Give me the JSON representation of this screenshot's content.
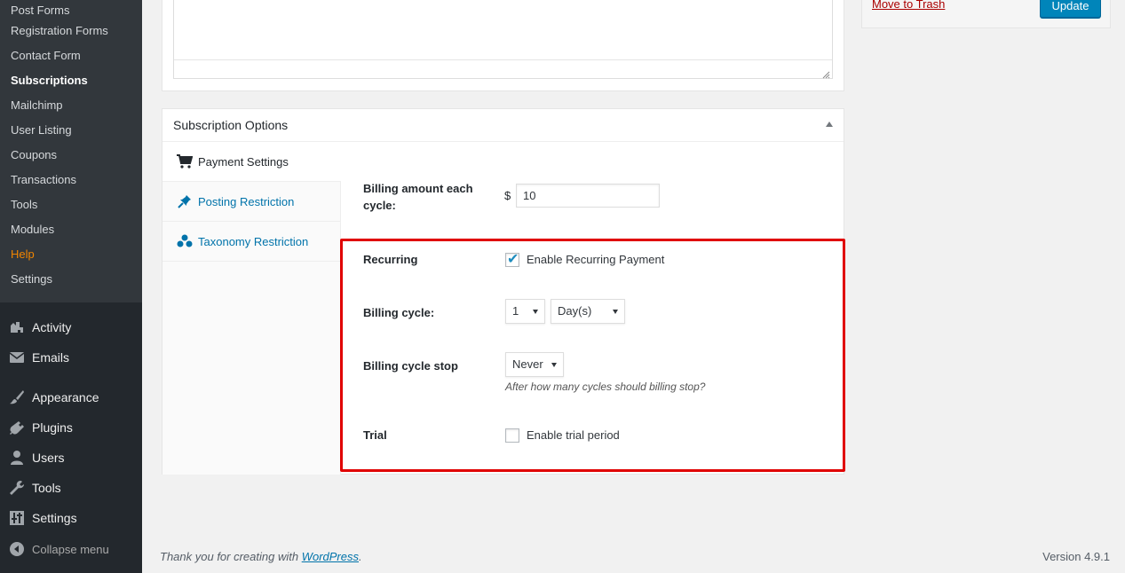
{
  "sidebar": {
    "submenu": [
      "Post Forms",
      "Registration Forms",
      "Contact Form",
      "Subscriptions",
      "Mailchimp",
      "User Listing",
      "Coupons",
      "Transactions",
      "Tools",
      "Modules",
      "Help",
      "Settings"
    ],
    "menu": {
      "activity": "Activity",
      "emails": "Emails",
      "appearance": "Appearance",
      "plugins": "Plugins",
      "users": "Users",
      "tools": "Tools",
      "settings": "Settings",
      "collapse": "Collapse menu"
    }
  },
  "publish": {
    "trash": "Move to Trash",
    "update": "Update"
  },
  "subscription": {
    "title": "Subscription Options",
    "tabs": {
      "payment": "Payment Settings",
      "posting": "Posting Restriction",
      "taxonomy": "Taxonomy Restriction"
    },
    "billing_amount_label_line1": "Billing amount each",
    "billing_amount_label_line2": "cycle:",
    "currency": "$",
    "billing_amount_value": "10",
    "recurring_label": "Recurring",
    "recurring_checkbox": "Enable Recurring Payment",
    "billing_cycle_label": "Billing cycle:",
    "billing_cycle_count": "1",
    "billing_cycle_unit": "Day(s)",
    "cycle_stop_label": "Billing cycle stop",
    "cycle_stop_value": "Never",
    "cycle_stop_hint": "After how many cycles should billing stop?",
    "trial_label": "Trial",
    "trial_checkbox": "Enable trial period"
  },
  "footer": {
    "thanks_prefix": "Thank you for creating with ",
    "wordpress": "WordPress",
    "thanks_suffix": ".",
    "version": "Version 4.9.1"
  },
  "colors": {
    "sidebar_bg": "#23282d",
    "submenu_bg": "#32373c",
    "help_orange": "#f18500",
    "link_blue": "#0073aa",
    "highlight_red": "#e00000",
    "button_blue": "#0085ba"
  }
}
